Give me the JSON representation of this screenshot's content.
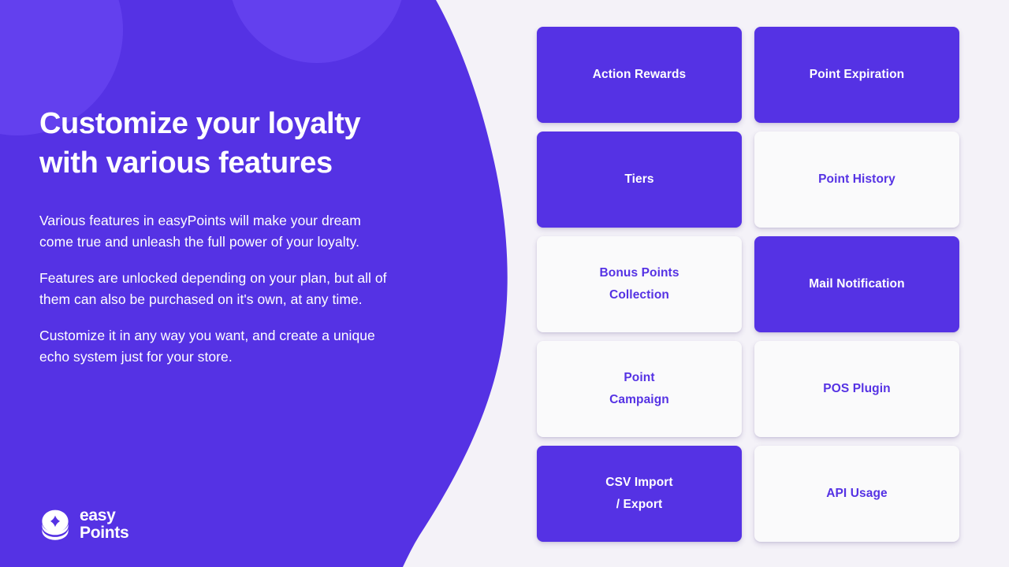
{
  "theme": {
    "brand_purple": "#5532E4",
    "brand_purple_light": "#6340EE",
    "page_background": "#F4F2F8",
    "card_white": "#FAFAFB",
    "text_on_purple": "#FFFFFF"
  },
  "hero": {
    "headline_line1": "Customize your loyalty",
    "headline_line2": "with various features",
    "paragraphs": [
      "Various features in easyPoints will make your dream come true and unleash the full power of your loyalty.",
      "Features are unlocked depending on your plan, but all of them can also be purchased on it's own, at any time.",
      "Customize it in any way you want, and create a unique echo system just for your store."
    ]
  },
  "logo": {
    "icon": "stacked-coins-diamond-icon",
    "word_top": "easy",
    "word_bottom": "Points"
  },
  "features": {
    "cards": [
      {
        "label": "Action Rewards",
        "lines": [
          "Action Rewards"
        ],
        "style": "filled"
      },
      {
        "label": "Point Expiration",
        "lines": [
          "Point Expiration"
        ],
        "style": "filled"
      },
      {
        "label": "Tiers",
        "lines": [
          "Tiers"
        ],
        "style": "filled"
      },
      {
        "label": "Point History",
        "lines": [
          "Point History"
        ],
        "style": "outline"
      },
      {
        "label": "Bonus Points Collection",
        "lines": [
          "Bonus Points",
          "Collection"
        ],
        "style": "outline"
      },
      {
        "label": "Mail Notification",
        "lines": [
          "Mail Notification"
        ],
        "style": "filled"
      },
      {
        "label": "Point Campaign",
        "lines": [
          "Point",
          "Campaign"
        ],
        "style": "outline"
      },
      {
        "label": "POS Plugin",
        "lines": [
          "POS Plugin"
        ],
        "style": "outline"
      },
      {
        "label": "CSV Import / Export",
        "lines": [
          "CSV Import",
          "/ Export"
        ],
        "style": "filled"
      },
      {
        "label": "API Usage",
        "lines": [
          "API Usage"
        ],
        "style": "outline"
      }
    ]
  }
}
